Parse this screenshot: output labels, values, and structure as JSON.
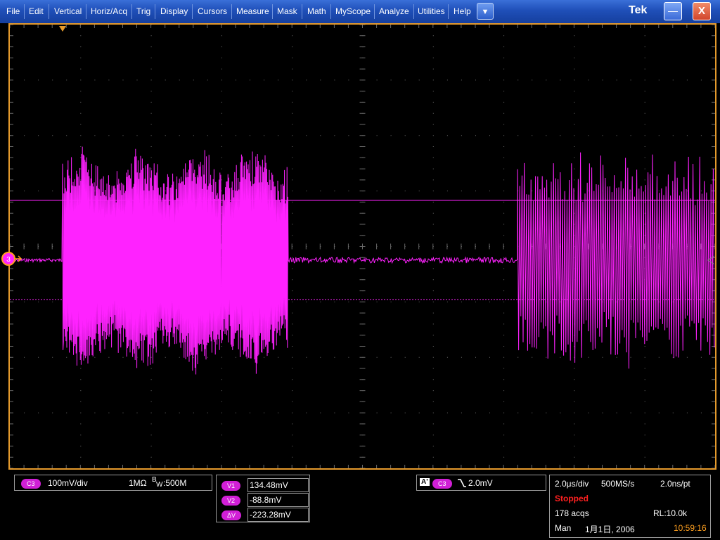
{
  "menu": {
    "items": [
      "File",
      "Edit",
      "Vertical",
      "Horiz/Acq",
      "Trig",
      "Display",
      "Cursors",
      "Measure",
      "Mask",
      "Math",
      "MyScope",
      "Analyze",
      "Utilities",
      "Help"
    ],
    "dropdown_icon": "▼",
    "brand": "Tek",
    "minimize_icon": "—",
    "close_icon": "X"
  },
  "channel": {
    "badge": "C3",
    "scale": "100mV/div",
    "impedance": "1MΩ",
    "bw_prefix": "B",
    "bw_sub": "W",
    "bandwidth": ":500M",
    "marker": "3",
    "color": "#ff22ff"
  },
  "cursors": {
    "rows": [
      {
        "badge": "V1",
        "value": "134.48mV"
      },
      {
        "badge": "V2",
        "value": "-88.8mV"
      },
      {
        "badge": "ΔV",
        "value": "-223.28mV"
      }
    ]
  },
  "trigger": {
    "mode_badge": "A'",
    "source_badge": "C3",
    "slope_icon": "falling-edge",
    "level": "2.0mV"
  },
  "acquisition": {
    "timebase": "2.0μs/div",
    "sample_rate": "500MS/s",
    "resolution": "2.0ns/pt",
    "status": "Stopped",
    "acqs": "178 acqs",
    "record_length": "RL:10.0k",
    "mode": "Man",
    "date": "1月1日, 2006",
    "time": "10:59:16"
  },
  "colors": {
    "trace": "#ff22ff",
    "graticule_border": "#e59a2c",
    "status_stopped": "#ff2020",
    "time": "#ffa020"
  }
}
